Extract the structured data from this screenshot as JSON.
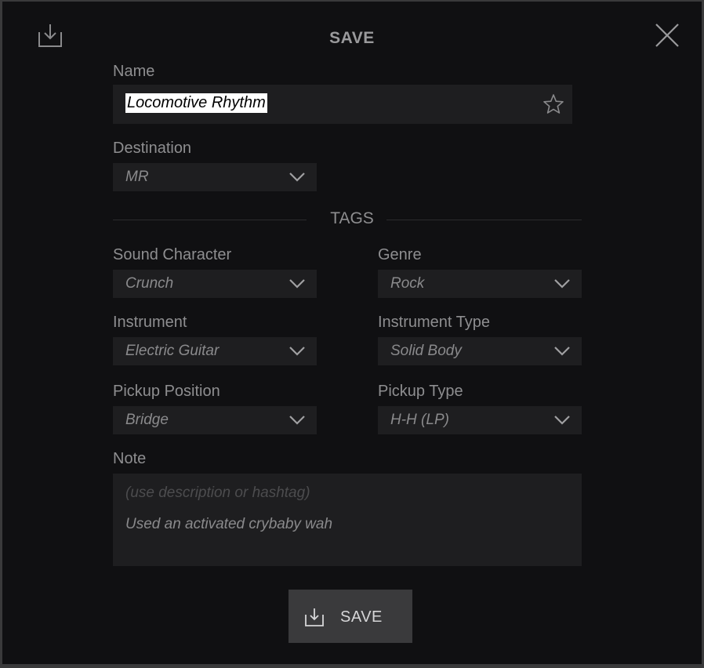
{
  "dialog": {
    "title": "SAVE",
    "import_icon": "import-icon",
    "close_icon": "close-icon"
  },
  "name": {
    "label": "Name",
    "value": "Locomotive Rhythm",
    "favorite_icon": "star-outline-icon"
  },
  "destination": {
    "label": "Destination",
    "value": "MR"
  },
  "tags": {
    "heading": "TAGS",
    "sound_character": {
      "label": "Sound Character",
      "value": "Crunch"
    },
    "genre": {
      "label": "Genre",
      "value": "Rock"
    },
    "instrument": {
      "label": "Instrument",
      "value": "Electric Guitar"
    },
    "instrument_type": {
      "label": "Instrument Type",
      "value": "Solid Body"
    },
    "pickup_position": {
      "label": "Pickup Position",
      "value": "Bridge"
    },
    "pickup_type": {
      "label": "Pickup Type",
      "value": "H-H (LP)"
    }
  },
  "note": {
    "label": "Note",
    "placeholder": "(use description or hashtag)",
    "value": "Used an activated crybaby wah"
  },
  "save_button": {
    "label": "SAVE",
    "icon": "save-icon"
  },
  "colors": {
    "background": "#101012",
    "field": "#1e1e20",
    "button": "#3a3a3c",
    "text": "#8e8e90"
  }
}
